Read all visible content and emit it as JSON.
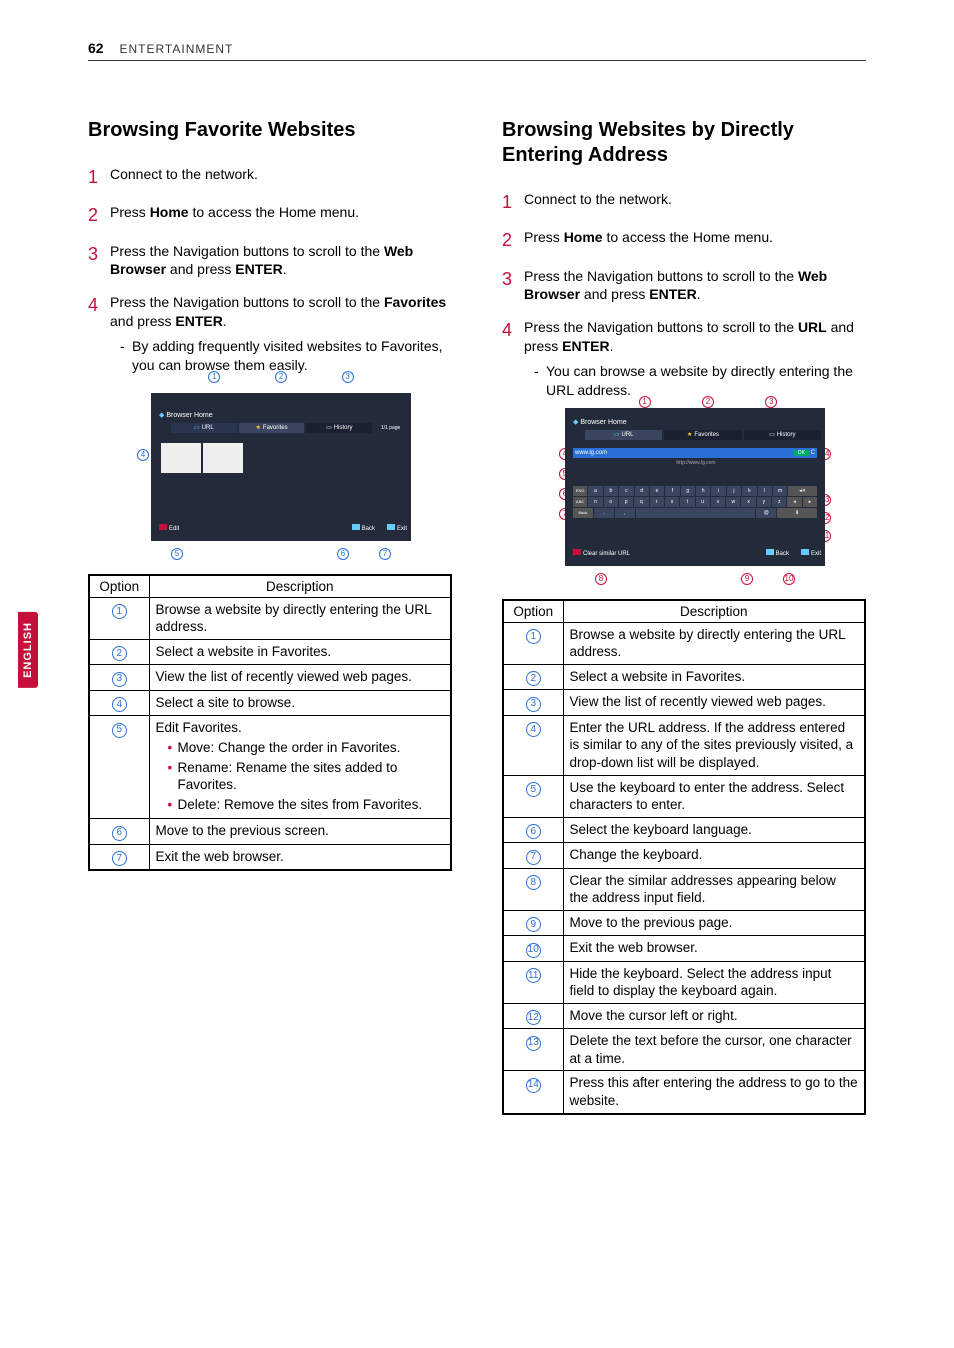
{
  "header": {
    "page": "62",
    "section": "ENTERTAINMENT"
  },
  "sideTab": "ENGLISH",
  "left": {
    "title": "Browsing Favorite Websites",
    "steps": {
      "s1": "Connect to the network.",
      "s2_a": "Press ",
      "s2_b": "Home",
      "s2_c": " to access the Home menu.",
      "s3_a": "Press the Navigation buttons to scroll to the ",
      "s3_b": "Web Browser",
      "s3_c": " and press ",
      "s3_d": "ENTER",
      "s3_e": ".",
      "s4_a": "Press the Navigation buttons to scroll to the ",
      "s4_b": "Favorites",
      "s4_c": " and press ",
      "s4_d": "ENTER",
      "s4_e": ".",
      "s4_sub": "By adding frequently visited websites to Favorites, you can browse them easily."
    },
    "fig": {
      "browserHome": "Browser Home",
      "tabURL": "URL",
      "tabFav": "Favorites",
      "tabHist": "History",
      "tabZoom": "1/1 page",
      "edit": "Edit",
      "back": "Back",
      "exit": "Exit"
    },
    "tbl": {
      "hOpt": "Option",
      "hDesc": "Description",
      "r1": "Browse a website by directly entering the URL address.",
      "r2": "Select a website in Favorites.",
      "r3": "View the list of recently viewed web pages.",
      "r4": "Select a site to browse.",
      "r5": "Edit Favorites.",
      "r5a": "Move: Change the order in Favorites.",
      "r5b": "Rename: Rename the sites added to Favorites.",
      "r5c": "Delete: Remove the sites from Favorites.",
      "r6": "Move to the previous screen.",
      "r7": "Exit the web browser."
    }
  },
  "right": {
    "title": "Browsing Websites by Directly Entering Address",
    "steps": {
      "s1": "Connect to the network.",
      "s2_a": "Press ",
      "s2_b": "Home",
      "s2_c": " to access the Home menu.",
      "s3_a": "Press the Navigation buttons to scroll to the ",
      "s3_b": "Web Browser",
      "s3_c": " and press ",
      "s3_d": "ENTER",
      "s3_e": ".",
      "s4_a": "Press the Navigation buttons to scroll to the ",
      "s4_b": "URL",
      "s4_c": " and press ",
      "s4_d": "ENTER",
      "s4_e": ".",
      "s4_sub": "You can browse a website by directly entering the URL address."
    },
    "fig": {
      "browserHome": "Browser Home",
      "tabURL": "URL",
      "tabFav": "Favorites",
      "tabHist": "History",
      "addr": "www.lg.com",
      "urlbar": "http://www.lg.com",
      "ok": "OK",
      "langEng": "ENG",
      "langAbc": "ABC",
      "langBack": "Back",
      "clear": "Clear similar URL",
      "back": "Back",
      "exit": "Exit",
      "keys_r1": [
        "a",
        "b",
        "c",
        "d",
        "e",
        "f",
        "g",
        "h",
        "i",
        "j",
        "k",
        "l",
        "m"
      ],
      "keys_r2": [
        "n",
        "o",
        "p",
        "q",
        "r",
        "s",
        "t",
        "u",
        "v",
        "w",
        "x",
        "y",
        "z"
      ]
    },
    "tbl": {
      "hOpt": "Option",
      "hDesc": "Description",
      "r1": "Browse a website by directly entering the URL address.",
      "r2": "Select a website in Favorites.",
      "r3": "View the list of recently viewed web pages.",
      "r4": "Enter the URL address. If the address entered is similar to any of the sites previously visited, a drop-down list will be displayed.",
      "r5": "Use the keyboard to enter the address. Select characters to enter.",
      "r6": "Select the keyboard language.",
      "r7": "Change the keyboard.",
      "r8": "Clear the similar addresses appearing below the address input field.",
      "r9": "Move to the previous page.",
      "r10": "Exit the web browser.",
      "r11": "Hide the keyboard. Select the address input field to display the keyboard again.",
      "r12": "Move the cursor left or right.",
      "r13": "Delete the text before the cursor, one character at a time.",
      "r14": "Press this after entering the address to go to the website."
    }
  }
}
